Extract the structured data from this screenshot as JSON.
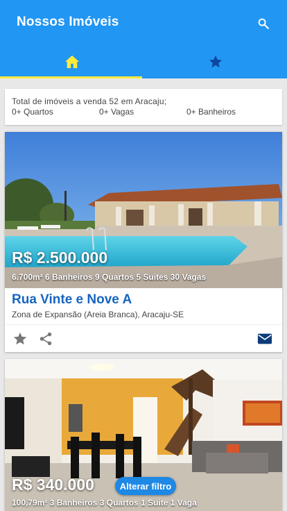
{
  "app": {
    "title": "Nossos Imóveis"
  },
  "appbar": {
    "search_icon": "search-icon"
  },
  "tabs": [
    {
      "name": "home",
      "icon": "home-icon",
      "selected": true
    },
    {
      "name": "favorites",
      "icon": "star-icon",
      "selected": false
    }
  ],
  "summary": {
    "line1": "Total de imóveis a venda 52 em Aracaju;",
    "quartos": "0+ Quartos",
    "vagas": "0+ Vagas",
    "banheiros": "0+ Banheiros"
  },
  "listings": [
    {
      "price": "R$ 2.500.000",
      "specs": "6.700m² 6 Banheiros 9 Quartos 5 Suites 30 Vagas",
      "street": "Rua Vinte e Nove A",
      "district": "Zona de Expansão (Areia Branca), Aracaju-SE"
    },
    {
      "price": "R$ 340.000",
      "specs": "100,79m² 3 Banheiros 3 Quartos 1 Suite 1 Vaga"
    }
  ],
  "filter_button": {
    "label": "Alterar filtro"
  },
  "colors": {
    "primary": "#2196f3",
    "accent": "#ffeb3b",
    "link": "#1565c0"
  }
}
